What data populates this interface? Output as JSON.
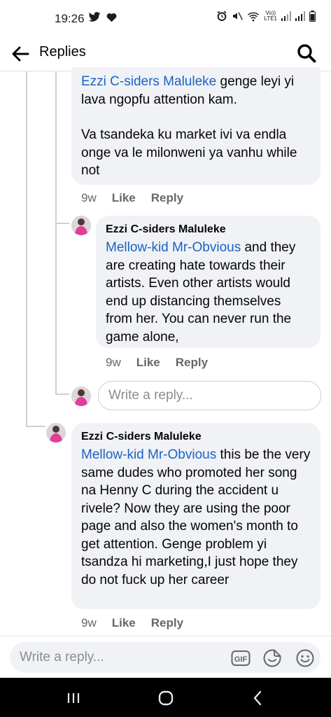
{
  "status_bar": {
    "time": "19:26",
    "left_icons": [
      "twitter-bird",
      "heart"
    ],
    "right_icons": [
      "alarm",
      "mute",
      "wifi",
      "volte",
      "signal-1",
      "signal-2",
      "battery"
    ],
    "volte_line1": "Vo))",
    "volte_line2": "LTE1"
  },
  "header": {
    "title": "Replies",
    "back_icon": "arrow-left-icon",
    "search_icon": "search-icon"
  },
  "comments": [
    {
      "author": "",
      "mention": "Ezzi C-siders Maluleke",
      "text_after_mention": " genge leyi yi lava ngopfu attention kam.",
      "paragraph2": "Va tsandeka ku market ivi va endla onge va le milonweni ya vanhu while not",
      "time": "9w",
      "like": "Like",
      "reply": "Reply"
    },
    {
      "author": "Ezzi C-siders Maluleke",
      "mention": "Mellow-kid Mr-Obvious",
      "text_after_mention": " and they are creating hate towards their artists. Even other artists would end up distancing themselves from her. You can never run the game alone,",
      "time": "9w",
      "like": "Like",
      "reply": "Reply"
    },
    {
      "author": "Ezzi C-siders Maluleke",
      "mention": "Mellow-kid Mr-Obvious",
      "text_after_mention": " this be the very same dudes who promoted her song na Henny C during the accident u rivele? Now they are using the poor page and also the women's month to get attention. Genge problem yi tsandza hi marketing,I just hope they do not fuck up her career",
      "time": "9w",
      "like": "Like",
      "reply": "Reply"
    }
  ],
  "inline_reply": {
    "placeholder": "Write a reply..."
  },
  "composer": {
    "placeholder": "Write a reply...",
    "gif_label": "GIF",
    "icons": [
      "gif-icon",
      "sticker-icon",
      "emoji-icon"
    ]
  },
  "nav": {
    "icons": [
      "recent-apps-icon",
      "home-icon",
      "back-nav-icon"
    ]
  },
  "colors": {
    "mention": "#1c62c4",
    "bubble": "#f0f2f5",
    "meta": "#65676b",
    "thread_line": "#ccd0d5"
  }
}
